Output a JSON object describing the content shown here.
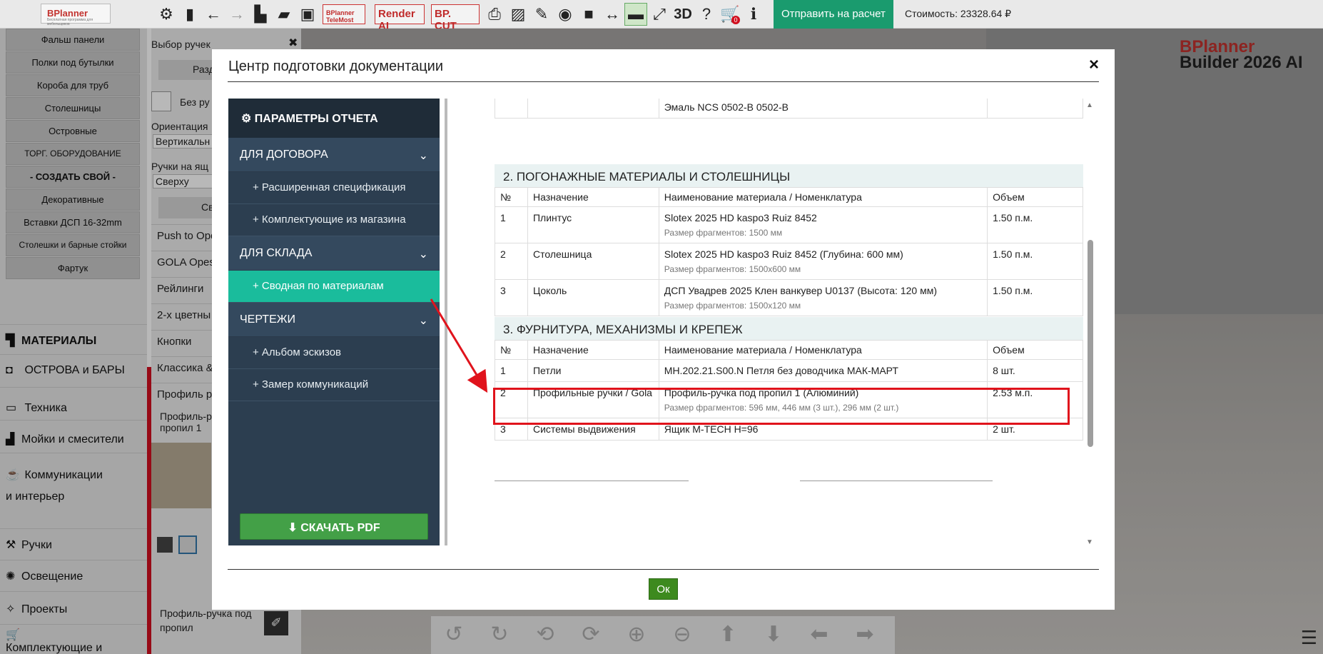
{
  "app": {
    "logo": "BPlanner",
    "logo_sub": "Бесплатная программа для мебельщиков",
    "toolbar_text_buttons": [
      "BPlanner TeleMost",
      "Render AI",
      "BP. CUT"
    ],
    "toolbar_3d": "3D",
    "cart_badge": "0",
    "send_button": "Отправить на расчет",
    "cost": "Стоимость: 23328.64 ₽",
    "brand_line1": "BPlanner",
    "brand_line2": "Builder 2026 AI"
  },
  "left_sidebar": {
    "buttons": [
      "Фальш панели",
      "Полки под бутылки",
      "Короба для труб",
      "Столешницы",
      "Островные",
      "ТОРГ. ОБОРУДОВАНИЕ",
      "- СОЗДАТЬ СВОЙ -",
      "Декоративные",
      "Вставки ДСП 16-32mm",
      "Столешки и барные стойки",
      "Фартук"
    ],
    "sections": [
      "МАТЕРИАЛЫ",
      "ОСТРОВА и БАРЫ",
      "Техника",
      "Мойки и смесители",
      "Коммуникации и интерьер",
      "Ручки",
      "Освещение",
      "Проекты",
      "Комплектующие и Услуги"
    ]
  },
  "middle_panel": {
    "title": "Выбор ручек",
    "close": "✖",
    "section_btn": "Разде",
    "no_handles": "Без ру",
    "orientation_label": "Ориентация",
    "orientation_value": "Вертикальн",
    "handles_on_label": "Ручки на ящ",
    "handles_on_value": "Сверху",
    "sve_btn": "Све",
    "items": [
      "Push to Ope",
      "GOLA Opes",
      "Рейлинги",
      "2-х цветны",
      "Кнопки",
      "Классика &",
      "Профиль р"
    ],
    "selected_item": "Профиль-р пропил 1",
    "bottom_label": "Профиль-ручка под пропил"
  },
  "modal": {
    "title": "Центр подготовки документации",
    "close": "×",
    "nav_header": "ПАРАМЕТРЫ ОТЧЕТА",
    "groups": [
      {
        "label": "ДЛЯ ДОГОВОРА",
        "items": [
          "+ Расширенная спецификация",
          "+ Комплектующие из магазина"
        ]
      },
      {
        "label": "ДЛЯ СКЛАДА",
        "items": [
          "+ Сводная по материалам"
        ]
      },
      {
        "label": "ЧЕРТЕЖИ",
        "items": [
          "+ Альбом эскизов",
          "+ Замер коммуникаций"
        ]
      }
    ],
    "download_button": "СКАЧАТЬ PDF",
    "ok_button": "Ок",
    "top_row": "Эмаль NCS 0502-B 0502-B",
    "headers": [
      "№",
      "Назначение",
      "Наименование материала / Номенклатура",
      "Объем"
    ],
    "section2": {
      "title": "2. ПОГОНАЖНЫЕ МАТЕРИАЛЫ И СТОЛЕШНИЦЫ",
      "rows": [
        {
          "n": "1",
          "purpose": "Плинтус",
          "name": "Slotex 2025 HD kaspo3 Ruiz 8452",
          "sub": "Размер фрагментов: 1500 мм",
          "vol": "1.50 п.м."
        },
        {
          "n": "2",
          "purpose": "Столешница",
          "name": "Slotex 2025 HD kaspo3 Ruiz 8452 (Глубина: 600 мм)",
          "sub": "Размер фрагментов: 1500x600 мм",
          "vol": "1.50 п.м."
        },
        {
          "n": "3",
          "purpose": "Цоколь",
          "name": "ДСП Увадрев 2025 Клен ванкувер U0137 (Высота: 120 мм)",
          "sub": "Размер фрагментов: 1500x120 мм",
          "vol": "1.50 п.м."
        }
      ]
    },
    "section3": {
      "title": "3. ФУРНИТУРА, МЕХАНИЗМЫ И КРЕПЕЖ",
      "rows": [
        {
          "n": "1",
          "purpose": "Петли",
          "name": "MH.202.21.S00.N Петля без доводчика МАК-МАРТ",
          "sub": "",
          "vol": "8 шт."
        },
        {
          "n": "2",
          "purpose": "Профильные ручки / Gola",
          "name": "Профиль-ручка под пропил 1 (Алюминий)",
          "sub": "Размер фрагментов: 596 мм, 446 мм (3 шт.), 296 мм (2 шт.)",
          "vol": "2.53 м.п."
        },
        {
          "n": "3",
          "purpose": "Системы выдвижения",
          "name": "Ящик M-TECH H=96",
          "sub": "",
          "vol": "2 шт."
        }
      ]
    }
  },
  "colors": {
    "accent": "#1abc9c",
    "send": "#1a9b6e",
    "download": "#43a047",
    "highlight": "#e0131c",
    "nav": "#2c3e50"
  }
}
